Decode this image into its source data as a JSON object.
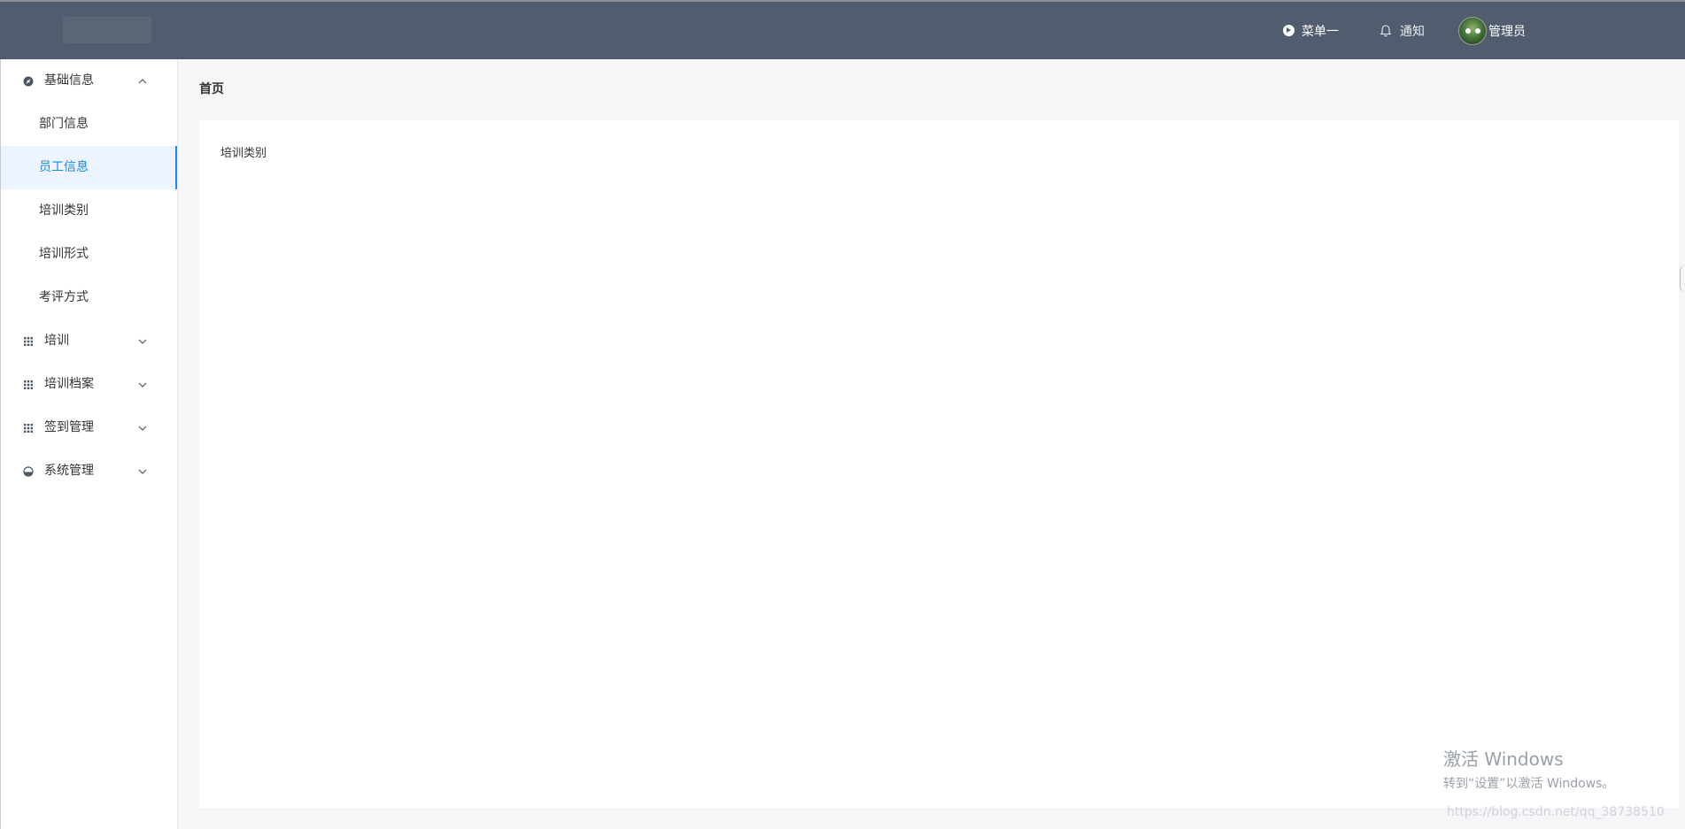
{
  "header": {
    "menu_label": "菜单一",
    "notify_label": "通知",
    "user_label": "管理员"
  },
  "sidebar": {
    "groups": [
      {
        "label": "基础信息",
        "expanded": true,
        "icon": "compass-icon",
        "items": [
          {
            "label": "部门信息",
            "active": false
          },
          {
            "label": "员工信息",
            "active": true
          },
          {
            "label": "培训类别",
            "active": false
          },
          {
            "label": "培训形式",
            "active": false
          },
          {
            "label": "考评方式",
            "active": false
          }
        ]
      },
      {
        "label": "培训",
        "expanded": false,
        "icon": "grid-icon"
      },
      {
        "label": "培训档案",
        "expanded": false,
        "icon": "grid-icon"
      },
      {
        "label": "签到管理",
        "expanded": false,
        "icon": "grid-icon"
      },
      {
        "label": "系统管理",
        "expanded": false,
        "icon": "settings-icon"
      }
    ]
  },
  "breadcrumb": "首页",
  "content": {
    "text": "培训类别"
  },
  "watermark": {
    "line1": "激活 Windows",
    "line2": "转到“设置”以激活 Windows。",
    "url": "https://blog.csdn.net/qq_38738510"
  },
  "colors": {
    "header_bg": "#525c6f",
    "active_text": "#1e88e5",
    "active_bg": "#ecf4ff"
  }
}
